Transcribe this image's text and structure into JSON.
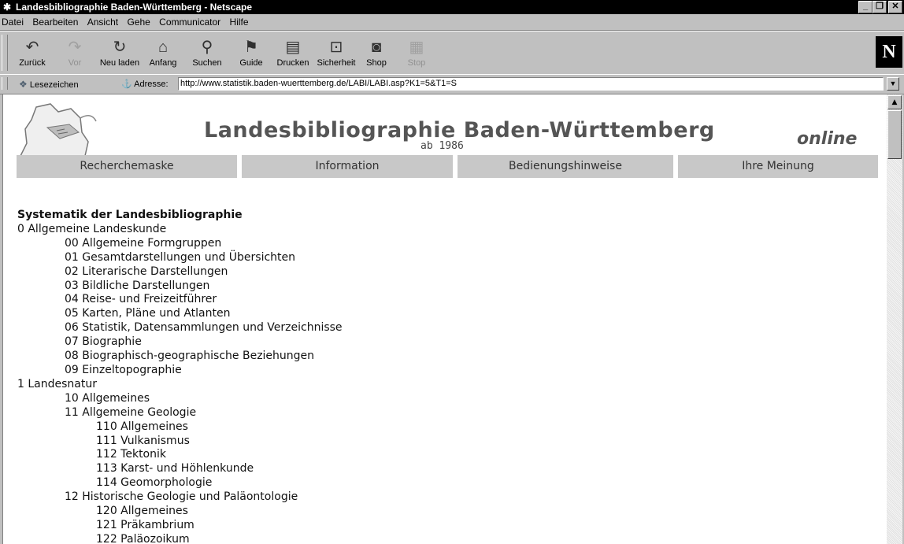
{
  "window": {
    "title": "Landesbibliographie Baden-Württemberg - Netscape"
  },
  "menu": [
    "Datei",
    "Bearbeiten",
    "Ansicht",
    "Gehe",
    "Communicator",
    "Hilfe"
  ],
  "toolbar": {
    "buttons": [
      {
        "label": "Zurück",
        "icon": "back-arrow-icon",
        "enabled": true
      },
      {
        "label": "Vor",
        "icon": "forward-arrow-icon",
        "enabled": false
      },
      {
        "label": "Neu laden",
        "icon": "reload-icon",
        "enabled": true
      },
      {
        "label": "Anfang",
        "icon": "home-icon",
        "enabled": true
      },
      {
        "label": "Suchen",
        "icon": "search-icon",
        "enabled": true
      },
      {
        "label": "Guide",
        "icon": "guide-icon",
        "enabled": true
      },
      {
        "label": "Drucken",
        "icon": "print-icon",
        "enabled": true
      },
      {
        "label": "Sicherheit",
        "icon": "lock-icon",
        "enabled": true
      },
      {
        "label": "Shop",
        "icon": "shop-icon",
        "enabled": true
      },
      {
        "label": "Stop",
        "icon": "stop-icon",
        "enabled": false
      }
    ],
    "logo": "N"
  },
  "location": {
    "bookmarks_label": "Lesezeichen",
    "address_label": "Adresse:",
    "url": "http://www.statistik.baden-wuerttemberg.de/LABI/LABI.asp?K1=5&T1=S"
  },
  "page": {
    "title": "Landesbibliographie Baden-Württemberg",
    "subtitle": "ab 1986",
    "online": "online",
    "nav": [
      "Recherchemaske",
      "Information",
      "Bedienungshinweise",
      "Ihre Meinung"
    ],
    "systematik_heading": "Systematik der Landesbibliographie",
    "items": [
      {
        "level": 1,
        "text": "0 Allgemeine Landeskunde"
      },
      {
        "level": 2,
        "text": "00 Allgemeine Formgruppen"
      },
      {
        "level": 2,
        "text": "01 Gesamtdarstellungen und Übersichten"
      },
      {
        "level": 2,
        "text": "02 Literarische Darstellungen"
      },
      {
        "level": 2,
        "text": "03 Bildliche Darstellungen"
      },
      {
        "level": 2,
        "text": "04 Reise- und Freizeitführer"
      },
      {
        "level": 2,
        "text": "05 Karten, Pläne und Atlanten"
      },
      {
        "level": 2,
        "text": "06 Statistik, Datensammlungen und Verzeichnisse"
      },
      {
        "level": 2,
        "text": "07 Biographie"
      },
      {
        "level": 2,
        "text": "08 Biographisch-geographische Beziehungen"
      },
      {
        "level": 2,
        "text": "09 Einzeltopographie"
      },
      {
        "level": 1,
        "text": "1 Landesnatur"
      },
      {
        "level": 2,
        "text": "10 Allgemeines"
      },
      {
        "level": 2,
        "text": "11 Allgemeine Geologie"
      },
      {
        "level": 3,
        "text": "110 Allgemeines"
      },
      {
        "level": 3,
        "text": "111 Vulkanismus"
      },
      {
        "level": 3,
        "text": "112 Tektonik"
      },
      {
        "level": 3,
        "text": "113 Karst- und Höhlenkunde"
      },
      {
        "level": 3,
        "text": "114 Geomorphologie"
      },
      {
        "level": 2,
        "text": "12 Historische Geologie und Paläontologie"
      },
      {
        "level": 3,
        "text": "120 Allgemeines"
      },
      {
        "level": 3,
        "text": "121 Präkambrium"
      },
      {
        "level": 3,
        "text": "122 Paläozoikum"
      }
    ]
  }
}
